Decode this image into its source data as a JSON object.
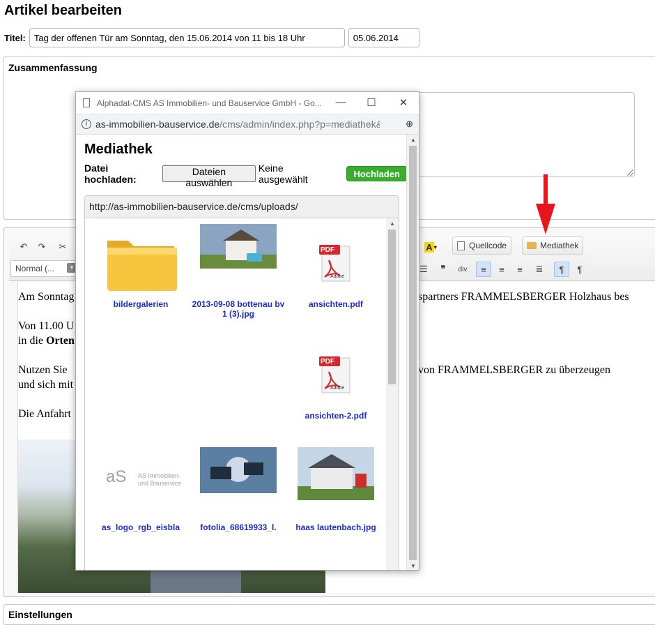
{
  "page": {
    "title": "Artikel bearbeiten"
  },
  "article": {
    "title_label": "Titel:",
    "title_value": "Tag der offenen Tür am Sonntag, den 15.06.2014 von 11 bis 18 Uhr",
    "date_value": "05.06.2014"
  },
  "summary": {
    "label": "Zusammenfassung"
  },
  "editor": {
    "toolbar": {
      "source_label": "Quellcode",
      "media_label": "Mediathek",
      "format_value": "Normal (..."
    },
    "content": {
      "line1_left": "Am Sonntag",
      "line1_right": "spartners  FRAMMELSBERGER Holzhaus bes",
      "line2_left": "Von 11.00 U",
      "line3_left": "in die ",
      "line3_bold": "Orten",
      "line4_left": "Nutzen Sie",
      "line4_right": "von FRAMMELSBERGER zu überzeugen",
      "line5_left": "und sich mit",
      "line6_left": "Die Anfahrt"
    }
  },
  "bottom": {
    "label": "Einstellungen"
  },
  "popup": {
    "window_title": "Alphadat-CMS AS Immobilien- und Bauservice GmbH - Go...",
    "url_host": "as-immobilien-bauservice.de",
    "url_path": "/cms/admin/index.php?p=mediathek&...",
    "heading": "Mediathek",
    "upload_label": "Datei hochladen:",
    "choose_button": "Dateien auswählen",
    "no_file": "Keine ausgewählt",
    "upload_button": "Hochladen",
    "path": "http://as-immobilien-bauservice.de/cms/uploads/",
    "files": [
      {
        "name": "bildergalerien",
        "type": "folder"
      },
      {
        "name": "2013-09-08 bottenau bv 1 (3).jpg",
        "type": "image"
      },
      {
        "name": "ansichten.pdf",
        "type": "pdf"
      },
      {
        "name": "ansichten-2.pdf",
        "type": "pdf"
      },
      {
        "name": "as_logo_rgb_eisbla",
        "type": "image"
      },
      {
        "name": "fotolia_68619933_l.",
        "type": "image"
      },
      {
        "name": "haas lautenbach.jpg",
        "type": "image"
      }
    ],
    "pdf_badge": "PDF",
    "adobe_text": "Adobe",
    "logo_text_1": "AS Immobilien-",
    "logo_text_2": "und Bauservice"
  },
  "colors": {
    "link": "#1c2ccd",
    "upload_green": "#3aad2e",
    "arrow_red": "#e8161b",
    "pdf_red": "#d9272b"
  }
}
